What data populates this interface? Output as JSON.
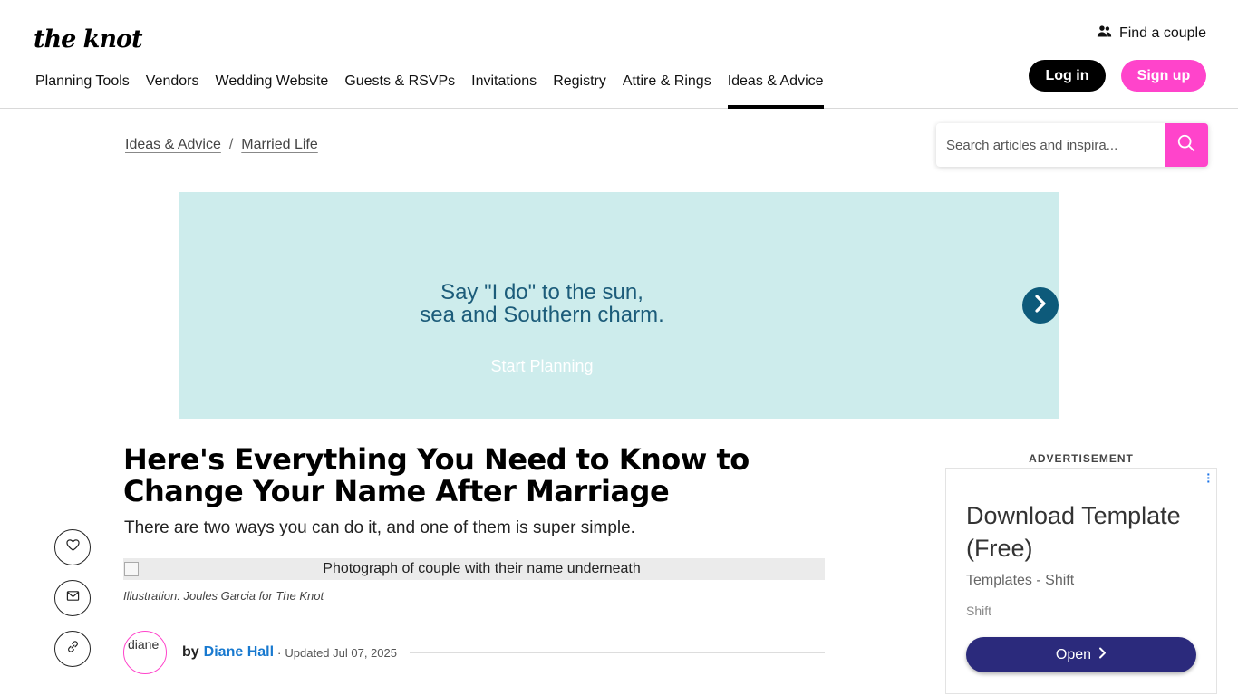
{
  "header": {
    "logo": "the knot",
    "find_couple": "Find a couple",
    "login": "Log in",
    "signup": "Sign up",
    "nav": [
      {
        "label": "Planning Tools"
      },
      {
        "label": "Vendors"
      },
      {
        "label": "Wedding Website"
      },
      {
        "label": "Guests & RSVPs"
      },
      {
        "label": "Invitations"
      },
      {
        "label": "Registry"
      },
      {
        "label": "Attire & Rings"
      },
      {
        "label": "Ideas & Advice",
        "active": true
      }
    ]
  },
  "breadcrumb": {
    "items": [
      "Ideas & Advice",
      "Married Life"
    ],
    "separator": "/"
  },
  "search": {
    "placeholder": "Search articles and inspira..."
  },
  "banner": {
    "line1": "Say \"I do\" to the sun,",
    "line2": "sea and Southern charm.",
    "cta": "Start Planning"
  },
  "article": {
    "title": "Here's Everything You Need to Know to Change Your Name After Marriage",
    "subtitle": "There are two ways you can do it, and one of them is super simple.",
    "image_alt": "Photograph of couple with their name underneath",
    "caption": "Illustration: Joules Garcia for The Knot",
    "avatar_alt": "diane",
    "by": "by",
    "author": "Diane Hall",
    "dot": "·",
    "updated": "Updated Jul 07, 2025"
  },
  "ad": {
    "label": "ADVERTISEMENT",
    "title": "Download Template (Free)",
    "subtitle": "Templates - Shift",
    "brand": "Shift",
    "button": "Open"
  },
  "colors": {
    "accent_pink": "#ff44cb",
    "banner_bg": "#cdecec",
    "banner_text": "#1c5c7a",
    "author_link": "#1879cf",
    "ad_button": "#2b2a7c"
  }
}
